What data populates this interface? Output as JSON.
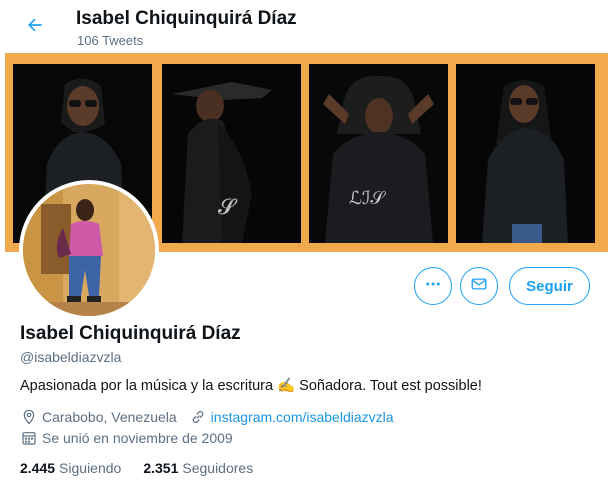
{
  "header": {
    "name": "Isabel Chiquinquirá Díaz",
    "tweet_count": "106 Tweets"
  },
  "profile": {
    "name": "Isabel Chiquinquirá Díaz",
    "handle": "@isabeldiazvzla",
    "bio": "Apasionada por la música y la escritura ✍️ Soñadora. Tout est possible!",
    "location": "Carabobo, Venezuela",
    "website": "instagram.com/isabeldiazvzla",
    "joined": "Se unió en noviembre de 2009"
  },
  "actions": {
    "more_icon": "more-icon",
    "message_icon": "envelope-icon",
    "follow_label": "Seguir"
  },
  "stats": {
    "following_count": "2.445",
    "following_label": "Siguiendo",
    "followers_count": "2.351",
    "followers_label": "Seguidores"
  },
  "colors": {
    "accent": "#1da1f2",
    "banner_background": "#f2a94b",
    "secondary_text": "#5b7083"
  }
}
